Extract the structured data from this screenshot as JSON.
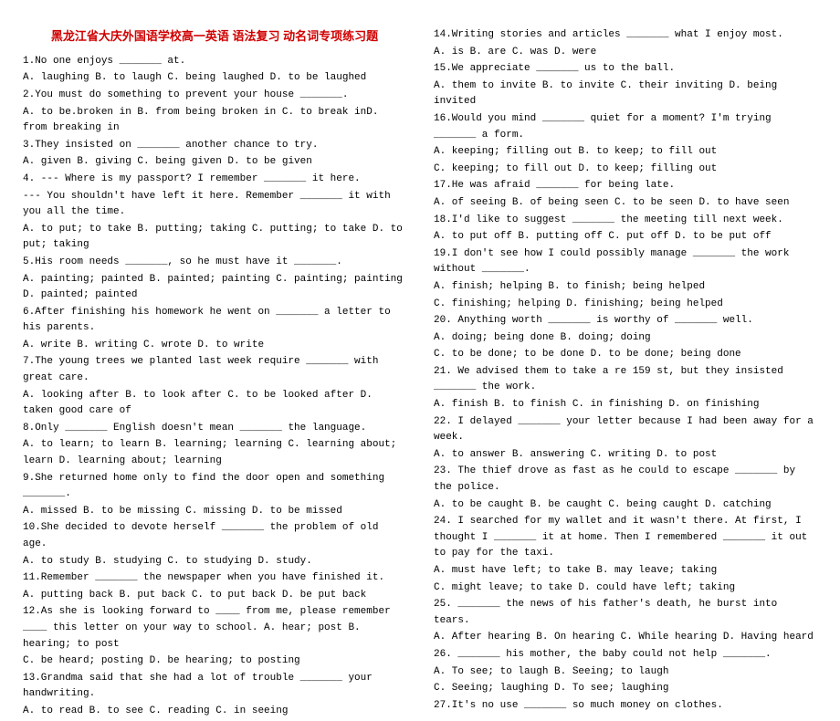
{
  "title": "黑龙江省大庆外国语学校高一英语 语法复习 动名词专项练习题",
  "left": [
    "1.No one enjoys _______ at.",
    "A. laughing   B. to laugh   C. being laughed  D. to be laughed",
    "2.You must do something to prevent your house _______.",
    "A. to be.broken in  B. from being broken in  C. to break inD. from breaking in",
    "3.They insisted on _______ another chance to try.",
    "A. given    B. giving   C. being given  D. to be given",
    "4. --- Where is my passport? I remember _______ it here.",
    "--- You shouldn't have left it here. Remember _______ it with you all the time.",
    "A. to put; to take   B. putting; taking C. putting; to take   D. to put; taking",
    "5.His room needs _______, so he must have it _______.",
    "A. painting; painted   B. painted; painting C. painting; painting   D. painted; painted",
    "6.After finishing his homework he went on _______ a letter to his parents.",
    "A. write    B. writing   C. wrote   D. to write",
    "7.The young trees we planted last week require _______ with great care.",
    "A. looking after    B. to look after  C. to be looked after   D. taken good care of",
    "8.Only _______ English doesn't mean _______ the language.",
    "A. to learn; to learn    B. learning; learning  C. learning about; learn   D. learning about; learning",
    "9.She returned home only to find the door open and something _______.",
    "A. missed    B. to be missing    C. missing    D. to be missed",
    "10.She decided to devote herself _______ the problem of old age.",
    "A. to study   B. studying   C. to studying   D. study.",
    "11.Remember _______ the newspaper when you have finished it.",
    "A. putting back   B. put back   C. to put back   D. be put back",
    "12.As she is looking forward to ____ from me, please remember ____ this letter on your way to school.      A. hear; post      B. hearing; to post",
    "C. be heard; posting    D. be hearing; to posting",
    "13.Grandma said that she had a lot of trouble _______ your handwriting.",
    "A. to read    B. to see    C. reading    C. in seeing"
  ],
  "right": [
    "14.Writing stories and articles _______ what I enjoy most.",
    "A. is      B. are      C. was    D. were",
    "15.We appreciate _______ us to the ball.",
    "A. them to invite  B. to invite   C. their inviting  D. being invited",
    "16.Would you mind _______ quiet for a moment? I'm trying _______ a form.",
    "A. keeping; filling out       B. to keep; to fill out",
    "C. keeping; to fill out       D. to keep; filling out",
    "17.He was afraid _______ for being late.",
    "A. of seeing    B. of being seen    C. to be seen   D. to have seen",
    "18.I'd like to suggest _______ the meeting till next week.",
    "A. to put off    B. putting off    C. put off    D. to be put off",
    "19.I don't see how I could possibly manage _______ the work without _______.",
    "A. finish; helping        B. to finish; being helped",
    "C. finishing; helping    D. finishing; being helped",
    "20. Anything worth _______ is worthy of _______ well.",
    "A. doing; being done    B. doing; doing",
    "C. to be done; to be done    D. to be done; being done",
    "21. We advised them to take a re 159 st, but they insisted _______ the work.",
    "A. finish     B. to finish   C. in finishing D. on finishing",
    "22. I delayed _______ your letter because I had been away for a week.",
    "A. to answer    B. answering    C. writing    D. to post",
    "23. The thief drove as fast as he could to escape _______ by the police.",
    "A. to be caught    B. be caught   C. being caught   D. catching",
    "24. I searched for my wallet and it wasn't there. At first, I thought I _______ it at home. Then I remembered _______ it out to pay for the taxi.",
    "A. must have left; to take    B. may leave; taking",
    "C. might leave; to take     D. could have left; taking",
    "25. _______ the news of his father's death, he burst into tears.",
    "A. After hearing   B. On hearing   C. While hearing  D. Having heard",
    "26. _______ his mother, the baby could not help _______.",
    "A. To see; to laugh  B. Seeing; to laugh",
    "C. Seeing; laughing   D. To see; laughing",
    "27.It's no use _______ so much money on clothes.   "
  ]
}
